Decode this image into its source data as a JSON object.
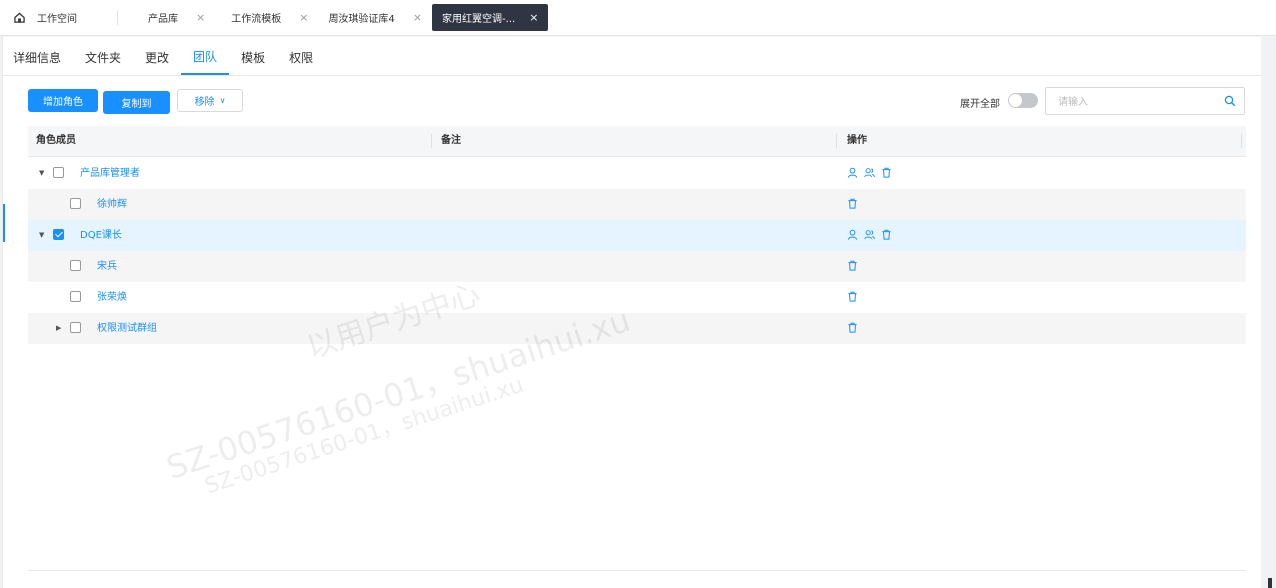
{
  "window_tabs": [
    {
      "label": "工作空间",
      "closable": false
    },
    {
      "label": "产品库",
      "closable": true
    },
    {
      "label": "工作流模板",
      "closable": true
    },
    {
      "label": "周汝琪验证库4",
      "closable": true
    },
    {
      "label": "家用红翼空调-...",
      "closable": true,
      "active": true
    }
  ],
  "sub_tabs": [
    "详细信息",
    "文件夹",
    "更改",
    "团队",
    "模板",
    "权限"
  ],
  "active_sub_tab": "团队",
  "toolbar": {
    "add_role": "增加角色",
    "copy_to": "复制到",
    "remove": "移除",
    "expand_all": "展开全部",
    "search_placeholder": "请输入"
  },
  "table": {
    "columns": [
      "角色成员",
      "备注",
      "操作"
    ],
    "rows": [
      {
        "name": "产品库管理者",
        "level": 0,
        "expanded": true,
        "checked": false,
        "ops": [
          "user-icon",
          "users-icon",
          "trash-icon"
        ]
      },
      {
        "name": "徐帅辉",
        "level": 1,
        "checked": false,
        "ops": [
          "trash-icon"
        ]
      },
      {
        "name": "DQE课长",
        "level": 0,
        "expanded": true,
        "checked": true,
        "ops": [
          "user-icon",
          "users-icon",
          "trash-icon"
        ]
      },
      {
        "name": "宋兵",
        "level": 1,
        "checked": false,
        "ops": [
          "trash-icon"
        ]
      },
      {
        "name": "张荣焕",
        "level": 1,
        "checked": false,
        "ops": [
          "trash-icon"
        ]
      },
      {
        "name": "权限测试群组",
        "level": 1,
        "expanded": false,
        "has_children": true,
        "checked": false,
        "ops": [
          "trash-icon"
        ]
      }
    ]
  },
  "watermarks": [
    "以用户为中心",
    "SZ-00576160-01，shuaihui.xu"
  ],
  "colors": {
    "accent": "#1890ff",
    "active_window_tab": "#2f3542",
    "selected_row": "#e6f4ff"
  }
}
